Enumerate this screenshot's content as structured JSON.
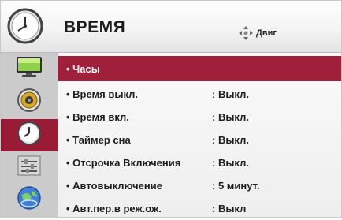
{
  "header": {
    "title": "ВРЕМЯ",
    "move_hint": "Двиг"
  },
  "sidebar": {
    "items": [
      {
        "icon": "picture-icon"
      },
      {
        "icon": "audio-icon"
      },
      {
        "icon": "clock-icon",
        "active": true
      },
      {
        "icon": "options-icon"
      },
      {
        "icon": "network-icon"
      }
    ]
  },
  "menu": {
    "rows": [
      {
        "label": "• Часы",
        "value": ""
      },
      {
        "label": "• Время выкл.",
        "value": ": Выкл."
      },
      {
        "label": "• Время вкл.",
        "value": ": Выкл."
      },
      {
        "label": "• Таймер сна",
        "value": ": Выкл."
      },
      {
        "label": "• Отсрочка Включения",
        "value": ": Выкл."
      },
      {
        "label": "• Автовыключение",
        "value": ": 5 минут."
      },
      {
        "label": "• Авт.пер.в реж.ож.",
        "value": ": Выкл"
      }
    ],
    "selected": 0
  },
  "colors": {
    "accent": "#a01f3b",
    "sidebar_bg": "#cbcbcb"
  }
}
